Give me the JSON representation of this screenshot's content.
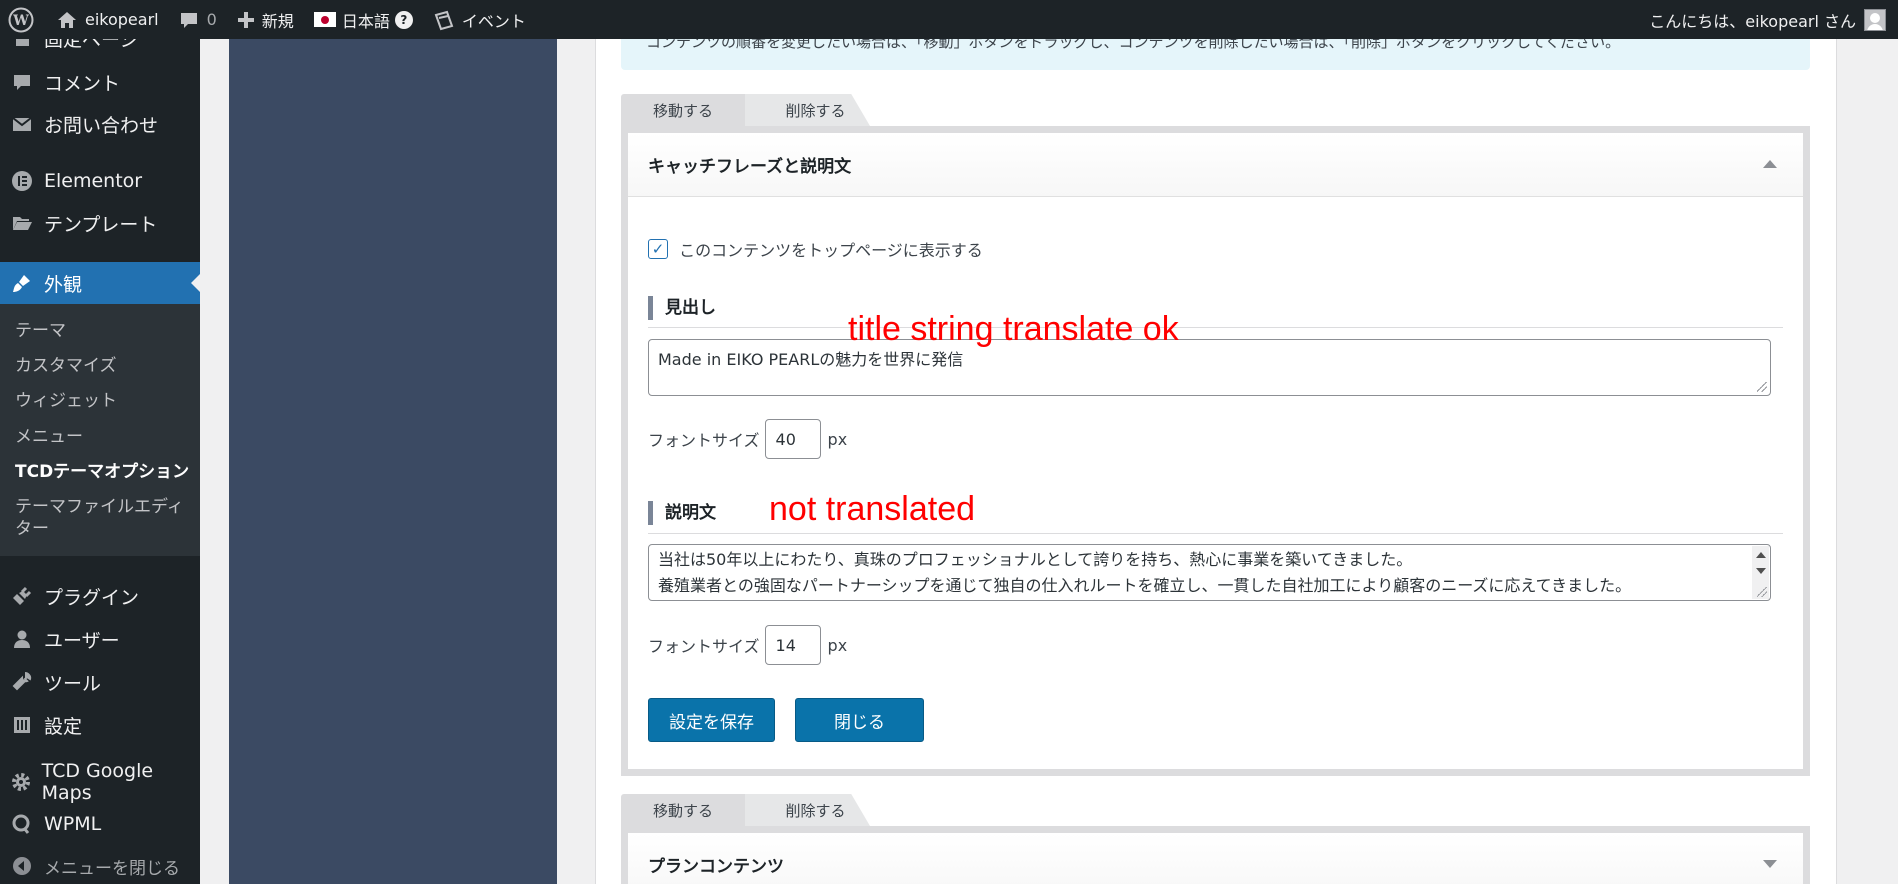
{
  "adminbar": {
    "site_name": "eikopearl",
    "comments_count": "0",
    "new_label": "新規",
    "language_label": "日本語",
    "help_label": "?",
    "events_label": "イベント",
    "greeting": "こんにちは、eikopearl さん"
  },
  "menu": {
    "fixed_pages": "固定ページ",
    "comments": "コメント",
    "contact": "お問い合わせ",
    "elementor": "Elementor",
    "templates": "テンプレート",
    "appearance": "外観",
    "sub": {
      "theme": "テーマ",
      "customize": "カスタマイズ",
      "widgets": "ウィジェット",
      "menus": "メニュー",
      "tcd_options": "TCDテーマオプション",
      "theme_editor": "テーマファイルエディター"
    },
    "plugins": "プラグイン",
    "users": "ユーザー",
    "tools": "ツール",
    "settings": "設定",
    "tcd_maps": "TCD Google Maps",
    "wpml": "WPML",
    "collapse": "メニューを閉じる"
  },
  "info_text": "コンテンツの順番を変更したい場合は、「移動」ボタンをドラッグし、コンテンツを削除したい場合は、「削除」ボタンをクリックしてください。",
  "block1": {
    "tab_move": "移動する",
    "tab_delete": "削除する",
    "header": "キャッチフレーズと説明文",
    "show_checkbox_label": "このコンテンツをトップページに表示する",
    "heading_section": "見出し",
    "heading_value": "Made in EIKO PEARLの魅力を世界に発信",
    "font_size_label": "フォントサイズ",
    "heading_font_size": "40",
    "unit": "px",
    "desc_section": "説明文",
    "desc_line1": "当社は50年以上にわたり、真珠のプロフェッショナルとして誇りを持ち、熱心に事業を築いてきました。",
    "desc_line2": "養殖業者との強固なパートナーシップを通じて独自の仕入れルートを確立し、一貫した自社加工により顧客のニーズに応えてきました。",
    "desc_font_size": "14",
    "save_button": "設定を保存",
    "close_button": "閉じる"
  },
  "block2": {
    "tab_move": "移動する",
    "tab_delete": "削除する",
    "header": "プランコンテンツ"
  },
  "annotations": {
    "title_ok": "title string translate ok",
    "not_translated": "not translated"
  }
}
